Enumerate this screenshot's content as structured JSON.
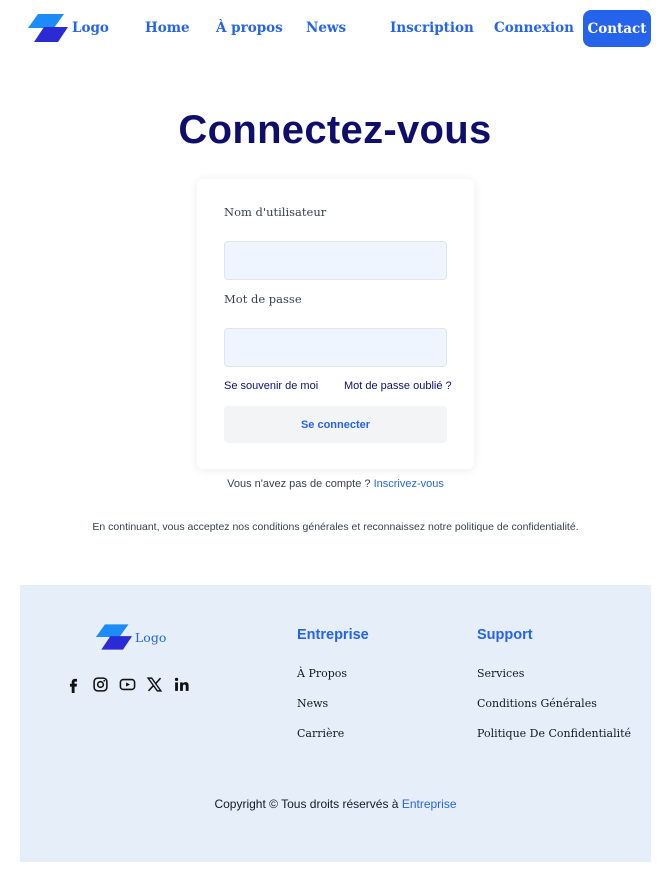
{
  "nav": {
    "logo_text": "Logo",
    "links": [
      "Home",
      "À propos",
      "News",
      "Inscription",
      "Connexion"
    ],
    "contact_label": "Contact"
  },
  "login": {
    "title": "Connectez-vous",
    "username_label": "Nom d'utilisateur",
    "username_value": "",
    "password_label": "Mot de passe",
    "password_value": "",
    "remember_label": "Se souvenir de moi",
    "forgot_label": "Mot de passe oublié ?",
    "submit_label": "Se connecter",
    "no_account_text": "Vous n'avez pas de compte ?",
    "signup_link": "Inscrivez-vous",
    "terms_text": "En continuant, vous acceptez nos conditions générales et reconnaissez notre politique de confidentialité."
  },
  "footer": {
    "logo_text": "Logo",
    "socials": [
      "facebook-icon",
      "instagram-icon",
      "youtube-icon",
      "x-icon",
      "linkedin-icon"
    ],
    "columns": [
      {
        "title": "Entreprise",
        "links": [
          "À Propos",
          "News",
          "Carrière"
        ]
      },
      {
        "title": "Support",
        "links": [
          "Services",
          "Conditions Générales",
          "Politique De Confidentialité"
        ]
      }
    ],
    "copyright_text": "Copyright © Tous droits réservés à",
    "copyright_brand": "Entreprise"
  },
  "colors": {
    "accent": "#2563eb",
    "title": "#0f0f6b",
    "input_bg": "#eff5ff",
    "footer_bg": "#e6eefa"
  }
}
